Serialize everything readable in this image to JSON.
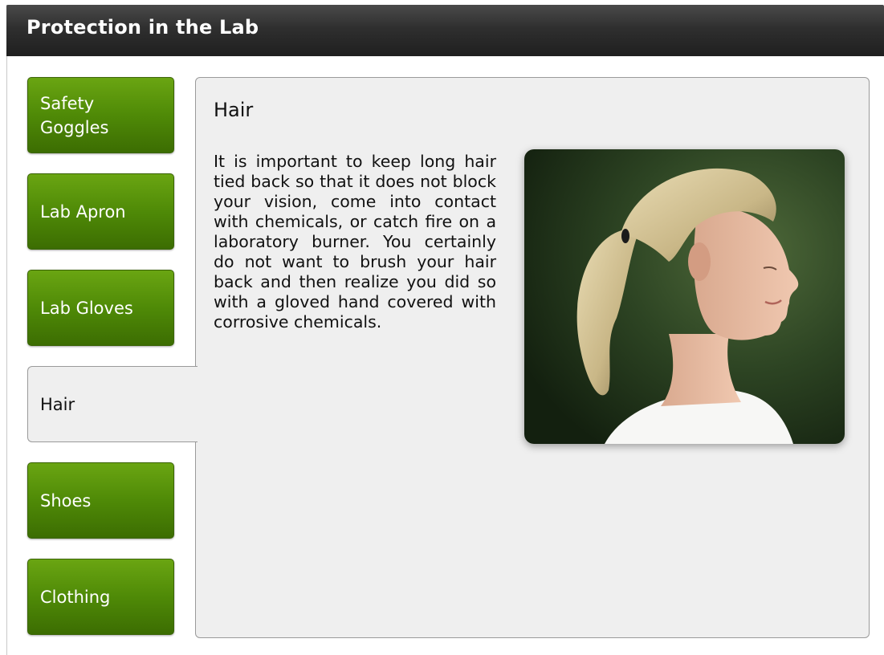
{
  "app": {
    "title": "Protection in the Lab"
  },
  "tabs": [
    {
      "label": "Safety\nGoggles",
      "active": false
    },
    {
      "label": "Lab Apron",
      "active": false
    },
    {
      "label": "Lab Gloves",
      "active": false
    },
    {
      "label": "Hair",
      "active": true
    },
    {
      "label": "Shoes",
      "active": false
    },
    {
      "label": "Clothing",
      "active": false
    }
  ],
  "content": {
    "heading": "Hair",
    "body": "It is important to keep long hair tied back so that it does not block your vision, come into contact with chemicals, or catch fire on a laboratory burner. You certainly do not want to brush your hair back and then realize you did so with a gloved hand covered with corrosive chemicals."
  },
  "colors": {
    "tab_green": "#4f8a07",
    "title_bar": "#2f2f2f",
    "panel_bg": "#efefef"
  }
}
